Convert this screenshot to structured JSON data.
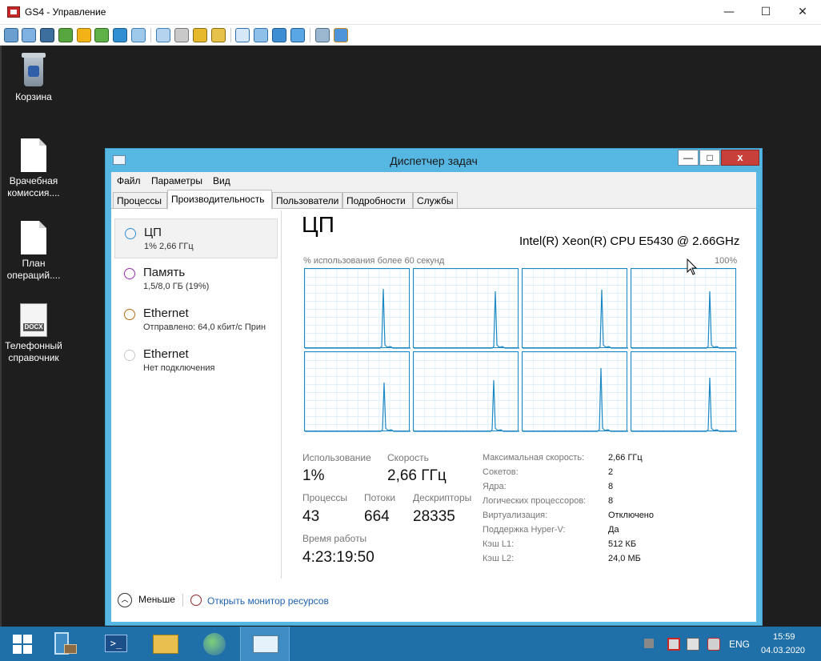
{
  "outer_window": {
    "title": "GS4 - Управление",
    "controls": {
      "minimize": "—",
      "maximize": "☐",
      "close": "✕"
    }
  },
  "toolbar_icons": [
    "display-icon",
    "fullscreen-icon",
    "console-icon",
    "sync-icon",
    "power-icon",
    "chat-icon",
    "phone-icon",
    "message-icon",
    "upload-icon",
    "network-icon",
    "lock-icon",
    "lock-open-icon",
    "window-icon",
    "fit-icon",
    "scale-icon",
    "zoom-icon",
    "windows-icon",
    "tools-icon"
  ],
  "desktop": {
    "icons": [
      {
        "label": "Корзина",
        "kind": "recycle-bin-icon"
      },
      {
        "label": "Врачебная комиссия....",
        "kind": "document-icon"
      },
      {
        "label": "План операций....",
        "kind": "document-icon"
      },
      {
        "label": "Телефонный справочник",
        "kind": "docx-icon",
        "badge": "DOCX"
      }
    ]
  },
  "task_manager": {
    "title": "Диспетчер задач",
    "controls": {
      "minimize": "—",
      "maximize": "□",
      "close": "x"
    },
    "menu": [
      "Файл",
      "Параметры",
      "Вид"
    ],
    "tabs": [
      "Процессы",
      "Производительность",
      "Пользователи",
      "Подробности",
      "Службы"
    ],
    "active_tab": "Производительность",
    "sidebar": [
      {
        "name": "ЦП",
        "sub": "1% 2,66 ГГц",
        "color": "#2f8fd2"
      },
      {
        "name": "Память",
        "sub": "1,5/8,0 ГБ (19%)",
        "color": "#9b2bb0"
      },
      {
        "name": "Ethernet",
        "sub": "Отправлено: 64,0 кбит/с Прин",
        "color": "#b46a14"
      },
      {
        "name": "Ethernet",
        "sub": "Нет подключения",
        "color": "#c8c8c8"
      }
    ],
    "main": {
      "heading": "ЦП",
      "model": "Intel(R) Xeon(R) CPU E5430 @ 2.66GHz",
      "graph_caption": "% использования более 60 секунд",
      "graph_max": "100%",
      "graph_color": "#1a88c4",
      "stats": {
        "usage_label": "Использование",
        "usage_value": "1%",
        "speed_label": "Скорость",
        "speed_value": "2,66 ГГц",
        "processes_label": "Процессы",
        "processes_value": "43",
        "threads_label": "Потоки",
        "threads_value": "664",
        "handles_label": "Дескрипторы",
        "handles_value": "28335",
        "uptime_label": "Время работы",
        "uptime_value": "4:23:19:50"
      },
      "details": [
        {
          "key": "Максимальная скорость:",
          "value": "2,66 ГГц"
        },
        {
          "key": "Сокетов:",
          "value": "2"
        },
        {
          "key": "Ядра:",
          "value": "8"
        },
        {
          "key": "Логических процессоров:",
          "value": "8"
        },
        {
          "key": "Виртуализация:",
          "value": "Отключено"
        },
        {
          "key": "Поддержка Hyper-V:",
          "value": "Да"
        },
        {
          "key": "Кэш L1:",
          "value": "512 КБ"
        },
        {
          "key": "Кэш L2:",
          "value": "24,0 МБ"
        }
      ]
    },
    "footer": {
      "less": "Меньше",
      "monitor_link": "Открыть монитор ресурсов"
    }
  },
  "taskbar": {
    "language": "ENG",
    "time": "15:59",
    "date": "04.03.2020",
    "accent": "#1f6fa8"
  }
}
